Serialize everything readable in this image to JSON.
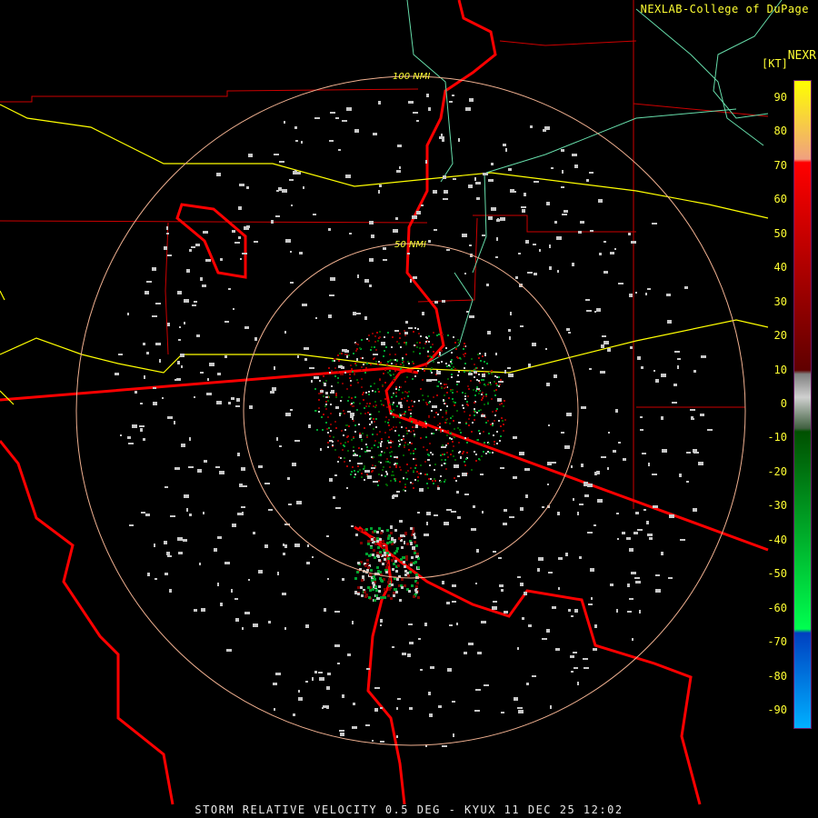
{
  "header": {
    "credit": "NEXLAB-College of DuPage",
    "product_code": "NEXR",
    "unit": "[KT]"
  },
  "caption": "STORM RELATIVE VELOCITY 0.5 DEG - KYUX 11 DEC 25 12:02",
  "range_rings": [
    {
      "label": "50 NMI"
    },
    {
      "label": "100 NMI"
    }
  ],
  "legend": {
    "ticks": [
      "90",
      "80",
      "70",
      "60",
      "50",
      "40",
      "30",
      "20",
      "10",
      "0",
      "-10",
      "-20",
      "-30",
      "-40",
      "-50",
      "-60",
      "-70",
      "-80",
      "-90"
    ],
    "tick_values": [
      90,
      80,
      70,
      60,
      50,
      40,
      30,
      20,
      10,
      0,
      -10,
      -20,
      -30,
      -40,
      -50,
      -60,
      -70,
      -80,
      -90
    ],
    "range": [
      -95,
      95
    ],
    "stops": [
      {
        "value": 95,
        "color": "#ffff00"
      },
      {
        "value": 72,
        "color": "#f0a080"
      },
      {
        "value": 71,
        "color": "#ff0000"
      },
      {
        "value": 10,
        "color": "#600000"
      },
      {
        "value": 9,
        "color": "#808080"
      },
      {
        "value": 2,
        "color": "#d0d0d0"
      },
      {
        "value": -7,
        "color": "#406040"
      },
      {
        "value": -8,
        "color": "#005000"
      },
      {
        "value": -66,
        "color": "#00ff50"
      },
      {
        "value": -67,
        "color": "#0040c0"
      },
      {
        "value": -95,
        "color": "#00b0ff"
      }
    ]
  },
  "colors": {
    "state_lines": "#ff0000",
    "county_lines": "#cc0000",
    "highways": "#ffff00",
    "rivers": "#66ddaa",
    "rings": "#f0b090",
    "text": "#ffff33"
  }
}
